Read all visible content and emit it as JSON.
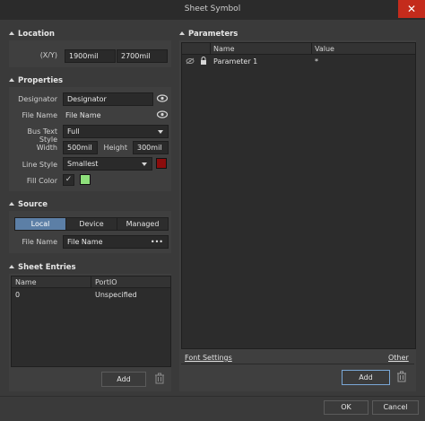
{
  "window": {
    "title": "Sheet Symbol",
    "close_glyph": "✕"
  },
  "location": {
    "header": "Location",
    "xy_label": "(X/Y)",
    "x_value": "1900mil",
    "y_value": "2700mil"
  },
  "properties": {
    "header": "Properties",
    "designator_label": "Designator",
    "designator_value": "Designator",
    "file_name_label": "File Name",
    "file_name_value": "File Name",
    "bus_text_style_label": "Bus Text Style",
    "bus_text_style_value": "Full",
    "width_label": "Width",
    "width_value": "500mil",
    "height_label": "Height",
    "height_value": "300mil",
    "line_style_label": "Line Style",
    "line_style_value": "Smallest",
    "line_color": "#8b0c0c",
    "fill_color_label": "Fill Color",
    "fill_checked_glyph": "✓",
    "fill_color": "#8ee07b",
    "icons": {
      "designator_visibility": "eye-icon",
      "file_name_visibility": "eye-icon"
    }
  },
  "source": {
    "header": "Source",
    "tabs": [
      {
        "label": "Local",
        "active": true
      },
      {
        "label": "Device",
        "active": false
      },
      {
        "label": "Managed",
        "active": false
      }
    ],
    "file_name_label": "File Name",
    "file_name_value": "File Name",
    "browse_glyph": "•••"
  },
  "sheet_entries": {
    "header": "Sheet Entries",
    "columns": [
      "Name",
      "PortIO"
    ],
    "rows": [
      {
        "name": "0",
        "portio": "Unspecified"
      }
    ],
    "add_label": "Add"
  },
  "parameters": {
    "header": "Parameters",
    "columns": [
      "Name",
      "Value"
    ],
    "rows": [
      {
        "name": "Parameter 1",
        "value": "*"
      }
    ],
    "font_settings_label": "Font Settings",
    "other_label": "Other",
    "add_label": "Add"
  },
  "footer": {
    "ok_label": "OK",
    "cancel_label": "Cancel"
  },
  "colors": {
    "accent": "#5c7fa6",
    "close": "#c42b1c",
    "background": "#3a3a3a"
  }
}
